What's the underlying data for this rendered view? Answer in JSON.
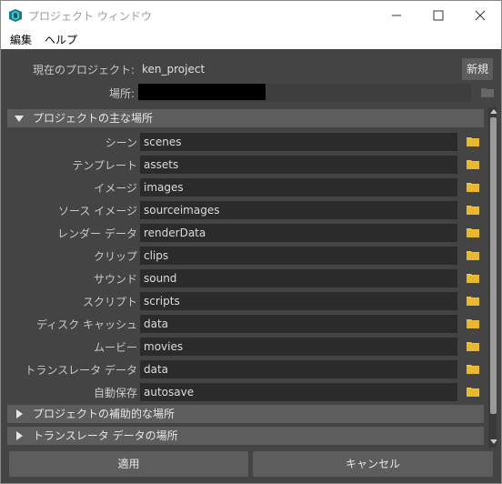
{
  "window": {
    "title": "プロジェクト ウィンドウ",
    "icons": {
      "app": "maya-app-icon",
      "minimize": "minimize-icon",
      "maximize": "maximize-icon",
      "close": "close-icon"
    }
  },
  "menu": [
    "編集",
    "ヘルプ"
  ],
  "current_project": {
    "label": "現在のプロジェクト:",
    "value": "ken_project",
    "new_button": "新規"
  },
  "location": {
    "label": "場所:",
    "value": ""
  },
  "sections": {
    "primary": {
      "title": "プロジェクトの主な場所",
      "expanded": true
    },
    "secondary": {
      "title": "プロジェクトの補助的な場所",
      "expanded": false
    },
    "translator": {
      "title": "トランスレータ データの場所",
      "expanded": false
    }
  },
  "dirs": [
    {
      "label": "シーン",
      "value": "scenes"
    },
    {
      "label": "テンプレート",
      "value": "assets"
    },
    {
      "label": "イメージ",
      "value": "images"
    },
    {
      "label": "ソース イメージ",
      "value": "sourceimages"
    },
    {
      "label": "レンダー データ",
      "value": "renderData"
    },
    {
      "label": "クリップ",
      "value": "clips"
    },
    {
      "label": "サウンド",
      "value": "sound"
    },
    {
      "label": "スクリプト",
      "value": "scripts"
    },
    {
      "label": "ディスク キャッシュ",
      "value": "data"
    },
    {
      "label": "ムービー",
      "value": "movies"
    },
    {
      "label": "トランスレータ データ",
      "value": "data"
    },
    {
      "label": "自動保存",
      "value": "autosave"
    }
  ],
  "buttons": {
    "apply": "適用",
    "cancel": "キャンセル"
  },
  "colors": {
    "folder": "#f0c040",
    "panel": "#444444",
    "field": "#2b2b2b",
    "button": "#5d5d5d"
  }
}
